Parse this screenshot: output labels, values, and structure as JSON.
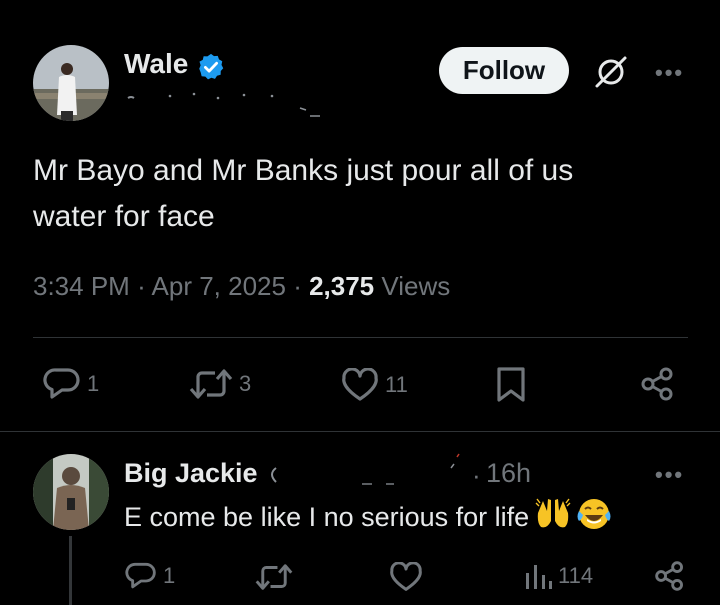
{
  "tweet": {
    "author_name": "Wale",
    "follow_label": "Follow",
    "text_line1": "Mr Bayo and Mr Banks just pour all of us",
    "text_line2": "water for face",
    "time": "3:34 PM",
    "date": "Apr 7, 2025",
    "views_count": "2,375",
    "views_label": "Views",
    "replies": "1",
    "reposts": "3",
    "likes": "11",
    "more": "•••"
  },
  "reply": {
    "author_name": "Big Jackie",
    "separator": "·",
    "time_ago": "16h",
    "text": "E come be like I no serious for life",
    "replies": "1",
    "views": "114",
    "more": "•••"
  },
  "colors": {
    "background": "#000000",
    "text": "#e7e9ea",
    "muted": "#71767b",
    "verified": "#1d9bf0",
    "divider": "#2f3336"
  }
}
